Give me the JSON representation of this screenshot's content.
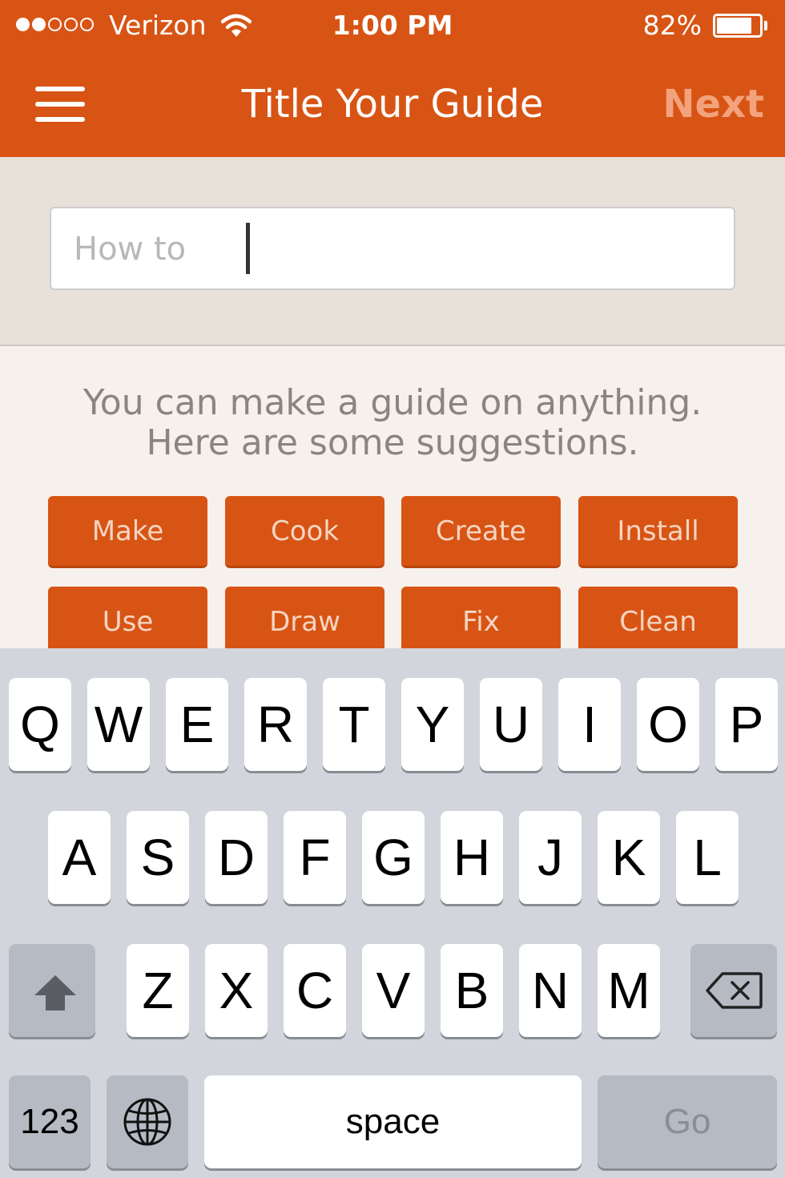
{
  "status_bar": {
    "carrier": "Verizon",
    "signal_bars_filled": 2,
    "signal_bars_total": 5,
    "time": "1:00 PM",
    "battery_percent": "82%",
    "battery_level": 0.82
  },
  "nav": {
    "menu_icon": "hamburger-menu-icon",
    "title": "Title Your Guide",
    "next_label": "Next"
  },
  "title_input": {
    "placeholder": "How to",
    "value": ""
  },
  "suggestions": {
    "hint_line1": "You can make a guide on anything.",
    "hint_line2": "Here are some suggestions.",
    "chips": [
      "Make",
      "Cook",
      "Create",
      "Install",
      "Use",
      "Draw",
      "Fix",
      "Clean"
    ]
  },
  "keyboard": {
    "row1": [
      "Q",
      "W",
      "E",
      "R",
      "T",
      "Y",
      "U",
      "I",
      "O",
      "P"
    ],
    "row2": [
      "A",
      "S",
      "D",
      "F",
      "G",
      "H",
      "J",
      "K",
      "L"
    ],
    "row3": [
      "Z",
      "X",
      "C",
      "V",
      "B",
      "N",
      "M"
    ],
    "numbers_label": "123",
    "space_label": "space",
    "go_label": "Go",
    "shift_icon": "shift-icon",
    "globe_icon": "globe-icon",
    "delete_icon": "delete-icon"
  },
  "colors": {
    "brand": "#d85414",
    "next_disabled": "#f2a27c",
    "keyboard_bg": "#d2d5db"
  }
}
